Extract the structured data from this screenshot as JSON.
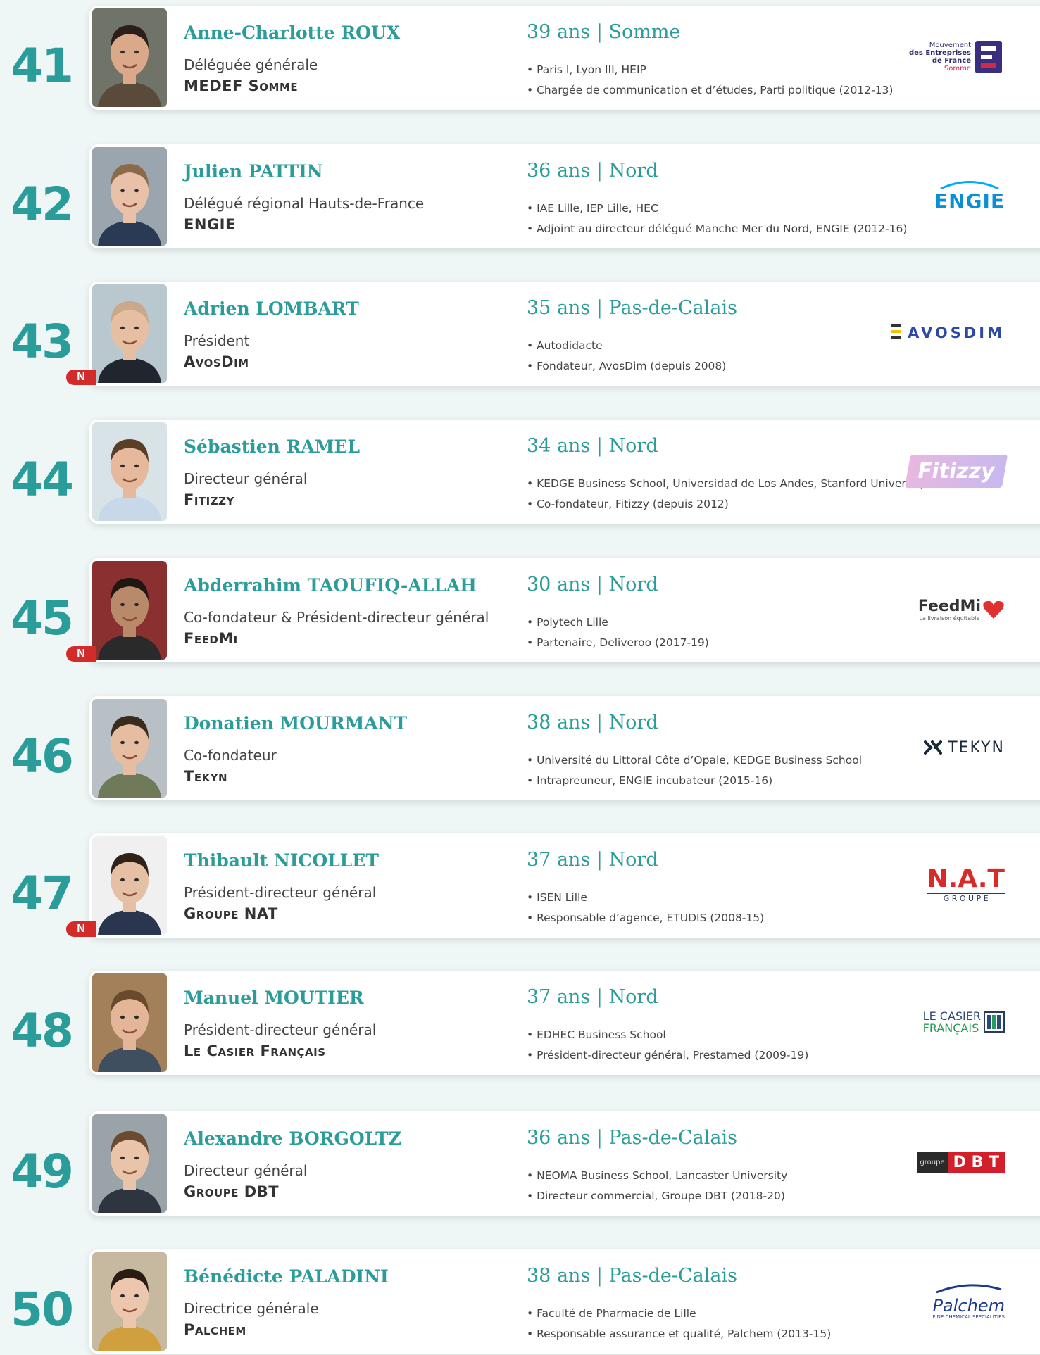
{
  "entries": [
    {
      "rank": "41",
      "new": "",
      "name": "Anne-Charlotte ROUX",
      "role": "Déléguée générale",
      "company": "MEDEF Somme",
      "age_region": "39 ans | Somme",
      "bullets": [
        "• Paris I, Lyon III, HEIP",
        "• Chargée de communication et d’études, Parti politique (2012-13)"
      ],
      "logo": {
        "name": "medef-logo",
        "lines": [
          "Mouvement",
          "des Entreprises",
          "de France",
          "Somme"
        ]
      }
    },
    {
      "rank": "42",
      "new": "",
      "name": "Julien PATTIN",
      "role": "Délégué régional Hauts-de-France",
      "company": "ENGIE",
      "age_region": "36 ans | Nord",
      "bullets": [
        "• IAE Lille, IEP Lille, HEC",
        "• Adjoint au directeur délégué Manche Mer du Nord, ENGIE (2012-16)"
      ],
      "logo": {
        "name": "engie-logo",
        "text": "ENGIE"
      }
    },
    {
      "rank": "43",
      "new": "N",
      "name": "Adrien LOMBART",
      "role": "Président",
      "company": "AvosDim",
      "age_region": "35 ans | Pas-de-Calais",
      "bullets": [
        "• Autodidacte",
        "• Fondateur, AvosDim (depuis 2008)"
      ],
      "logo": {
        "name": "avosdim-logo",
        "text": "AVOSDIM"
      }
    },
    {
      "rank": "44",
      "new": "",
      "name": "Sébastien RAMEL",
      "role": "Directeur général",
      "company": "Fitizzy",
      "age_region": "34 ans | Nord",
      "bullets": [
        "• KEDGE Business School, Universidad de Los Andes, Stanford University",
        "• Co-fondateur, Fitizzy (depuis 2012)"
      ],
      "logo": {
        "name": "fitizzy-logo",
        "text": "Fitizzy"
      }
    },
    {
      "rank": "45",
      "new": "N",
      "name": "Abderrahim TAOUFIQ-ALLAH",
      "role": "Co-fondateur & Président-directeur général",
      "company": "FeedMi",
      "age_region": "30 ans | Nord",
      "bullets": [
        "• Polytech Lille",
        "• Partenaire, Deliveroo (2017-19)"
      ],
      "logo": {
        "name": "feedmi-logo",
        "text": "FeedMi",
        "sub": "La livraison équitable"
      }
    },
    {
      "rank": "46",
      "new": "",
      "name": "Donatien MOURMANT",
      "role": "Co-fondateur",
      "company": "Tekyn",
      "age_region": "38 ans | Nord",
      "bullets": [
        "• Université du Littoral Côte d’Opale, KEDGE Business School",
        "• Intrapreuneur, ENGIE incubateur (2015-16)"
      ],
      "logo": {
        "name": "tekyn-logo",
        "text": "TEKYN"
      }
    },
    {
      "rank": "47",
      "new": "N",
      "name": "Thibault NICOLLET",
      "role": "Président-directeur général",
      "company": "Groupe NAT",
      "age_region": "37 ans | Nord",
      "bullets": [
        "• ISEN Lille",
        "• Responsable d’agence, ETUDIS (2008-15)"
      ],
      "logo": {
        "name": "nat-logo",
        "text": "N.A.T",
        "sub": "G R O U P E"
      }
    },
    {
      "rank": "48",
      "new": "",
      "name": "Manuel MOUTIER",
      "role": "Président-directeur général",
      "company": "Le Casier Français",
      "age_region": "37 ans | Nord",
      "bullets": [
        "• EDHEC Business School",
        "• Président-directeur général, Prestamed (2009-19)"
      ],
      "logo": {
        "name": "casier-francais-logo",
        "text": "LE CASIER",
        "sub": "FRANÇAIS"
      }
    },
    {
      "rank": "49",
      "new": "",
      "name": "Alexandre BORGOLTZ",
      "role": "Directeur général",
      "company": "Groupe DBT",
      "age_region": "36 ans | Pas-de-Calais",
      "bullets": [
        "• NEOMA Business School, Lancaster University",
        "• Directeur commercial, Groupe DBT (2018-20)"
      ],
      "logo": {
        "name": "dbt-logo",
        "text": "D B T",
        "sub": "groupe"
      }
    },
    {
      "rank": "50",
      "new": "",
      "name": "Bénédicte PALADINI",
      "role": "Directrice générale",
      "company": "Palchem",
      "age_region": "38 ans | Pas-de-Calais",
      "bullets": [
        "• Faculté de Pharmacie de Lille",
        "• Responsable assurance et qualité, Palchem (2013-15)"
      ],
      "logo": {
        "name": "palchem-logo",
        "text": "Palchem",
        "sub": "FINE CHEMICAL SPECIALITIES"
      }
    }
  ],
  "colors": {
    "accent": "#2a9d9a",
    "badge": "#d32a2a"
  }
}
